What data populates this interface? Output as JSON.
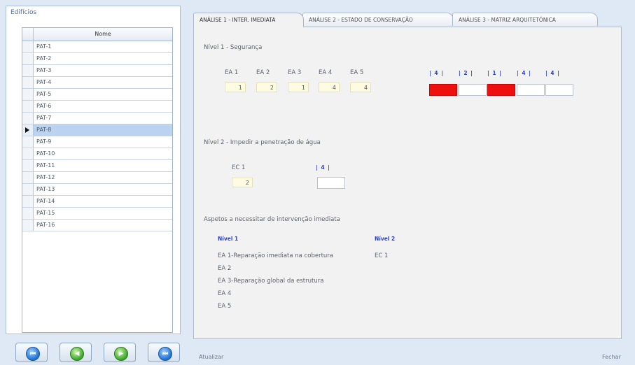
{
  "window": {
    "background": "#dfe9f5",
    "accent": "#2a3fd0",
    "alert_color": "#ee0f0f"
  },
  "left_panel": {
    "title": "Edifícios",
    "grid": {
      "column_header": "Nome",
      "rows": [
        "PAT-1",
        "PAT-2",
        "PAT-3",
        "PAT-4",
        "PAT-5",
        "PAT-6",
        "PAT-7",
        "PAT-8",
        "PAT-9",
        "PAT-10",
        "PAT-11",
        "PAT-12",
        "PAT-13",
        "PAT-14",
        "PAT-15",
        "PAT-16"
      ],
      "selected_row": "PAT-8"
    },
    "nav_buttons": [
      {
        "icon": "first-record-icon",
        "color": "blue",
        "glyph": "⏮"
      },
      {
        "icon": "previous-record-icon",
        "color": "green",
        "glyph": "◀"
      },
      {
        "icon": "next-record-icon",
        "color": "green",
        "glyph": "▶"
      },
      {
        "icon": "last-record-icon",
        "color": "blue",
        "glyph": "⏭"
      }
    ]
  },
  "tabs": [
    {
      "label": "ANÁLISE 1 - INTER. IMEDIATA",
      "active": true
    },
    {
      "label": "ANÁLISE 2 - ESTADO DE CONSERVAÇÃO",
      "active": false
    },
    {
      "label": "ANÁLISE 3 - MATRIZ ARQUITETÓNICA",
      "active": false
    }
  ],
  "nivel1": {
    "title": "Nível 1 - Segurança",
    "items": [
      {
        "label": "EA 1",
        "value": "1"
      },
      {
        "label": "EA 2",
        "value": "2"
      },
      {
        "label": "EA 3",
        "value": "1"
      },
      {
        "label": "EA 4",
        "value": "4"
      },
      {
        "label": "EA 5",
        "value": "4"
      }
    ],
    "scale": [
      "4",
      "2",
      "1",
      "4",
      "4"
    ],
    "results": [
      true,
      false,
      true,
      false,
      false
    ]
  },
  "nivel2": {
    "title": "Nível 2 - Impedir a penetração de água",
    "items": [
      {
        "label": "EC 1",
        "value": "2"
      }
    ],
    "scale": [
      "4"
    ],
    "results": [
      false
    ]
  },
  "aspects": {
    "title": "Aspetos a necessitar de intervenção imediata",
    "col1_header": "Nível 1",
    "col2_header": "Nível 2",
    "col1": [
      "EA 1-Reparação imediata na cobertura",
      "EA 2",
      "EA 3-Reparação global da estrutura",
      "EA 4",
      "EA 5"
    ],
    "col2": [
      "EC 1"
    ]
  },
  "footer": {
    "update_label": "Atualizar",
    "close_label": "Fechar"
  }
}
